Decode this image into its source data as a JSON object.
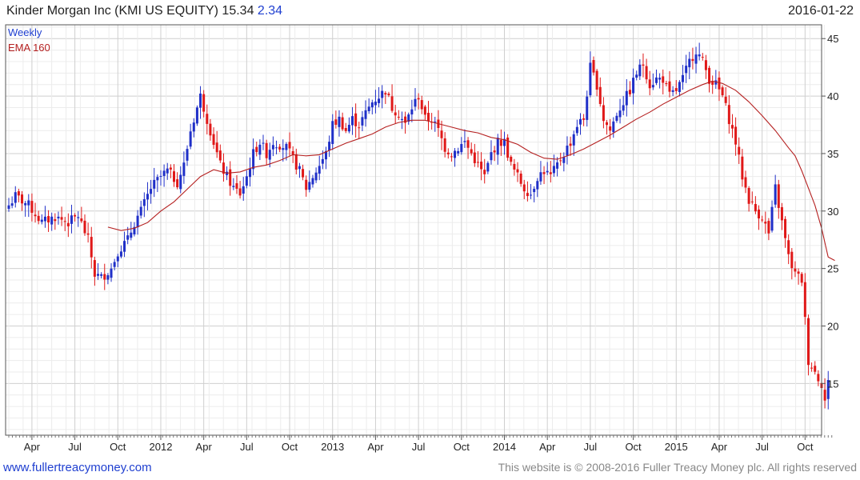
{
  "header": {
    "title": "Kinder Morgan Inc (KMI US EQUITY)",
    "price": "15.34",
    "change": "2.34",
    "date": "2016-01-22"
  },
  "footer": {
    "website": "www.fullertreacymoney.com",
    "copyright": "This website is © 2008-2016 Fuller Treacy Money plc. All rights reserved"
  },
  "colors": {
    "up": "#1f2fc8",
    "down": "#e01818",
    "ema": "#b52020",
    "grid": "#d9d9d9"
  },
  "chart_data": {
    "type": "candlestick",
    "legend": [
      {
        "label": "Weekly",
        "color": "#1f3fd0"
      },
      {
        "label": "EMA 160",
        "color": "#b52020"
      }
    ],
    "y_ticks": [
      15,
      20,
      25,
      30,
      35,
      40,
      45
    ],
    "ylim": [
      10.5,
      46.2
    ],
    "x_ticks": [
      {
        "label": "Apr",
        "week": 7
      },
      {
        "label": "Jul",
        "week": 20
      },
      {
        "label": "Oct",
        "week": 33
      },
      {
        "label": "2012",
        "week": 46
      },
      {
        "label": "Apr",
        "week": 59
      },
      {
        "label": "Jul",
        "week": 72
      },
      {
        "label": "Oct",
        "week": 85
      },
      {
        "label": "2013",
        "week": 98
      },
      {
        "label": "Apr",
        "week": 111
      },
      {
        "label": "Jul",
        "week": 124
      },
      {
        "label": "Oct",
        "week": 137
      },
      {
        "label": "2014",
        "week": 150
      },
      {
        "label": "Apr",
        "week": 163
      },
      {
        "label": "Jul",
        "week": 176
      },
      {
        "label": "Oct",
        "week": 189
      },
      {
        "label": "2015",
        "week": 202
      },
      {
        "label": "Apr",
        "week": 215
      },
      {
        "label": "Jul",
        "week": 228
      },
      {
        "label": "Oct",
        "week": 241
      }
    ],
    "close_anchors": [
      [
        0,
        30.5
      ],
      [
        2,
        31.3
      ],
      [
        6,
        30.5
      ],
      [
        10,
        29.0
      ],
      [
        14,
        29.5
      ],
      [
        18,
        29.0
      ],
      [
        21,
        29.6
      ],
      [
        24,
        27.5
      ],
      [
        26,
        24.5
      ],
      [
        28,
        24.2
      ],
      [
        31,
        25.0
      ],
      [
        33,
        26.5
      ],
      [
        36,
        27.5
      ],
      [
        38,
        29.0
      ],
      [
        40,
        30.0
      ],
      [
        43,
        32.0
      ],
      [
        46,
        33.0
      ],
      [
        48,
        33.5
      ],
      [
        51,
        32.5
      ],
      [
        53,
        34.0
      ],
      [
        55,
        37.0
      ],
      [
        57,
        39.0
      ],
      [
        58,
        40.0
      ],
      [
        60,
        38.0
      ],
      [
        62,
        36.0
      ],
      [
        64,
        34.0
      ],
      [
        66,
        33.0
      ],
      [
        68,
        32.0
      ],
      [
        70,
        31.5
      ],
      [
        72,
        33.0
      ],
      [
        74,
        35.0
      ],
      [
        76,
        36.0
      ],
      [
        78,
        35.0
      ],
      [
        80,
        36.0
      ],
      [
        82,
        35.8
      ],
      [
        84,
        35.5
      ],
      [
        86,
        34.5
      ],
      [
        88,
        33.5
      ],
      [
        90,
        32.0
      ],
      [
        92,
        33.0
      ],
      [
        94,
        34.0
      ],
      [
        96,
        35.0
      ],
      [
        98,
        37.5
      ],
      [
        100,
        38.0
      ],
      [
        102,
        37.0
      ],
      [
        104,
        38.0
      ],
      [
        106,
        37.5
      ],
      [
        108,
        38.5
      ],
      [
        110,
        39.5
      ],
      [
        112,
        40.0
      ],
      [
        114,
        40.5
      ],
      [
        116,
        39.0
      ],
      [
        118,
        38.5
      ],
      [
        120,
        37.5
      ],
      [
        122,
        39.0
      ],
      [
        124,
        40.0
      ],
      [
        126,
        38.0
      ],
      [
        128,
        38.0
      ],
      [
        130,
        37.0
      ],
      [
        132,
        35.5
      ],
      [
        134,
        35.0
      ],
      [
        136,
        35.5
      ],
      [
        138,
        36.0
      ],
      [
        140,
        35.0
      ],
      [
        142,
        34.0
      ],
      [
        144,
        33.0
      ],
      [
        146,
        35.0
      ],
      [
        148,
        36.0
      ],
      [
        150,
        36.0
      ],
      [
        152,
        34.0
      ],
      [
        154,
        33.0
      ],
      [
        156,
        32.0
      ],
      [
        158,
        31.5
      ],
      [
        160,
        33.0
      ],
      [
        162,
        33.5
      ],
      [
        164,
        33.0
      ],
      [
        166,
        34.0
      ],
      [
        168,
        35.0
      ],
      [
        170,
        36.0
      ],
      [
        172,
        37.5
      ],
      [
        174,
        38.0
      ],
      [
        176,
        42.5
      ],
      [
        178,
        41.0
      ],
      [
        180,
        38.0
      ],
      [
        182,
        37.0
      ],
      [
        184,
        38.5
      ],
      [
        186,
        39.5
      ],
      [
        188,
        40.5
      ],
      [
        190,
        42.0
      ],
      [
        192,
        42.8
      ],
      [
        194,
        41.0
      ],
      [
        196,
        41.5
      ],
      [
        198,
        41.5
      ],
      [
        200,
        40.0
      ],
      [
        202,
        40.5
      ],
      [
        204,
        41.5
      ],
      [
        206,
        43.0
      ],
      [
        208,
        44.0
      ],
      [
        210,
        43.0
      ],
      [
        212,
        41.5
      ],
      [
        214,
        41.0
      ],
      [
        216,
        40.0
      ],
      [
        218,
        38.0
      ],
      [
        220,
        36.0
      ],
      [
        222,
        33.0
      ],
      [
        224,
        31.0
      ],
      [
        226,
        30.0
      ],
      [
        228,
        29.5
      ],
      [
        230,
        28.0
      ],
      [
        232,
        32.0
      ],
      [
        234,
        29.0
      ],
      [
        236,
        26.0
      ],
      [
        238,
        24.5
      ],
      [
        240,
        24.0
      ],
      [
        242,
        17.0
      ],
      [
        244,
        16.0
      ],
      [
        246,
        15.0
      ],
      [
        247,
        13.5
      ],
      [
        248,
        15.3
      ]
    ],
    "ema_160": [
      [
        30,
        28.6
      ],
      [
        34,
        28.3
      ],
      [
        38,
        28.5
      ],
      [
        42,
        29.0
      ],
      [
        46,
        30.0
      ],
      [
        50,
        30.8
      ],
      [
        54,
        31.9
      ],
      [
        58,
        33.0
      ],
      [
        62,
        33.6
      ],
      [
        66,
        33.3
      ],
      [
        70,
        33.4
      ],
      [
        74,
        33.8
      ],
      [
        78,
        34.0
      ],
      [
        82,
        34.4
      ],
      [
        86,
        34.9
      ],
      [
        90,
        34.8
      ],
      [
        94,
        34.9
      ],
      [
        98,
        35.4
      ],
      [
        102,
        35.9
      ],
      [
        106,
        36.3
      ],
      [
        110,
        36.7
      ],
      [
        114,
        37.3
      ],
      [
        118,
        37.7
      ],
      [
        122,
        37.9
      ],
      [
        126,
        37.9
      ],
      [
        130,
        37.6
      ],
      [
        134,
        37.3
      ],
      [
        138,
        37.0
      ],
      [
        142,
        36.8
      ],
      [
        146,
        36.4
      ],
      [
        150,
        36.2
      ],
      [
        154,
        35.8
      ],
      [
        158,
        35.1
      ],
      [
        162,
        34.6
      ],
      [
        166,
        34.5
      ],
      [
        170,
        34.9
      ],
      [
        174,
        35.4
      ],
      [
        178,
        36.0
      ],
      [
        182,
        36.6
      ],
      [
        186,
        37.3
      ],
      [
        190,
        38.0
      ],
      [
        194,
        38.6
      ],
      [
        198,
        39.3
      ],
      [
        202,
        39.9
      ],
      [
        206,
        40.5
      ],
      [
        210,
        41.0
      ],
      [
        213,
        41.3
      ],
      [
        216,
        41.1
      ],
      [
        220,
        40.5
      ],
      [
        224,
        39.5
      ],
      [
        228,
        38.3
      ],
      [
        232,
        37.0
      ],
      [
        236,
        35.5
      ],
      [
        238,
        34.8
      ],
      [
        240,
        33.5
      ],
      [
        242,
        32.0
      ],
      [
        244,
        30.5
      ],
      [
        246,
        28.5
      ],
      [
        248,
        26.0
      ],
      [
        250,
        25.7
      ]
    ]
  }
}
